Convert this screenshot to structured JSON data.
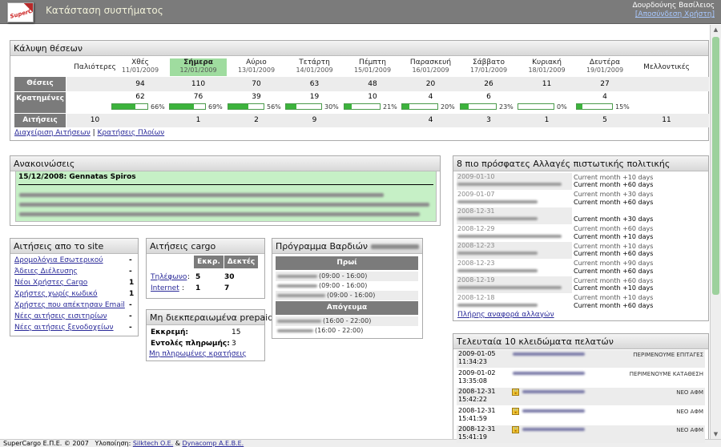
{
  "header": {
    "title": "Κατάσταση συστήματος",
    "user": "Δουρδούνης Βασίλειος",
    "logout": "[Αποσύνδεση Χρήστη]",
    "logo_text": "SuperCargo"
  },
  "coverage": {
    "title": "Κάλυψη θέσεων",
    "days": [
      {
        "name": "Παλιότερες",
        "date": ""
      },
      {
        "name": "Χθές",
        "date": "11/01/2009"
      },
      {
        "name": "Σήμερα",
        "date": "12/01/2009"
      },
      {
        "name": "Αύριο",
        "date": "13/01/2009"
      },
      {
        "name": "Τετάρτη",
        "date": "14/01/2009"
      },
      {
        "name": "Πέμπτη",
        "date": "15/01/2009"
      },
      {
        "name": "Παρασκευή",
        "date": "16/01/2009"
      },
      {
        "name": "Σάββατο",
        "date": "17/01/2009"
      },
      {
        "name": "Κυριακή",
        "date": "18/01/2009"
      },
      {
        "name": "Δευτέρα",
        "date": "19/01/2009"
      },
      {
        "name": "Μελλοντικές",
        "date": ""
      }
    ],
    "row_labels": [
      "Θέσεις",
      "Κρατημένες",
      "Αιτήσεις"
    ],
    "seats": [
      "",
      "94",
      "110",
      "70",
      "63",
      "48",
      "20",
      "26",
      "11",
      "27",
      ""
    ],
    "booked": [
      "",
      "62",
      "76",
      "39",
      "19",
      "10",
      "4",
      "6",
      "",
      "4",
      ""
    ],
    "booked_pct": [
      null,
      66,
      69,
      56,
      30,
      21,
      20,
      23,
      0,
      15,
      null
    ],
    "booked_pct_label": [
      "",
      "66%",
      "69%",
      "56%",
      "30%",
      "21%",
      "20%",
      "23%",
      "0%",
      "15%",
      ""
    ],
    "requests": [
      "10",
      "",
      "1",
      "2",
      "9",
      "",
      "4",
      "3",
      "1",
      "5",
      "11"
    ],
    "link1": "Διαχείριση Αιτήσεων",
    "sep": "|",
    "link2": "Κρατήσεις Πλοίων"
  },
  "announcements": {
    "title": "Ανακοινώσεις",
    "heading": "15/12/2008: Gennatas Spiros"
  },
  "policy": {
    "title": "8 πιο πρόσφατες Αλλαγές πιστωτικής πολιτικής",
    "items": [
      {
        "date": "2009-01-10",
        "desc": "Current month +10 days",
        "desc2": "Current month +60 days"
      },
      {
        "date": "2009-01-07",
        "desc": "Current month +30 days",
        "desc2": "Current month +60 days"
      },
      {
        "date": "2008-12-31",
        "desc": "",
        "desc2": "Current month +30 days"
      },
      {
        "date": "2008-12-29",
        "desc": "Current month +60 days",
        "desc2": "Current month +10 days"
      },
      {
        "date": "2008-12-23",
        "desc": "Current month +10 days",
        "desc2": "Current month +60 days"
      },
      {
        "date": "2008-12-23",
        "desc": "Current month +90 days",
        "desc2": "Current month +60 days"
      },
      {
        "date": "2008-12-19",
        "desc": "Current month +60 days",
        "desc2": "Current month +10 days"
      },
      {
        "date": "2008-12-18",
        "desc": "Current month +10 days",
        "desc2": "Current month +60 days"
      }
    ],
    "link": "Πλήρης αναφορά αλλαγών"
  },
  "site_requests": {
    "title": "Αιτήσεις απο το site",
    "items": [
      {
        "label": "Δρομολόγια Εσωτερικού",
        "val": "-"
      },
      {
        "label": "Άδειες Διέλευσης",
        "val": "-"
      },
      {
        "label": "Νέοι Χρήστες Cargo",
        "val": "1"
      },
      {
        "label": "Χρήστες χωρίς κωδικό",
        "val": "1"
      },
      {
        "label": "Χρήστες που απέκτησαν Email",
        "val": "-"
      },
      {
        "label": "Νέες αιτήσεις εισιτηρίων",
        "val": "-"
      },
      {
        "label": "Νέες αιτήσεις ξενοδοχείων",
        "val": "-"
      }
    ]
  },
  "cargo": {
    "title": "Αιτήσεις cargo",
    "col1": "Εκκρ.",
    "col2": "Δεκτές",
    "rows": [
      {
        "label": "Τηλέφωνο",
        "a": "5",
        "b": "30"
      },
      {
        "label": "Internet",
        "a": "1",
        "b": "7"
      }
    ]
  },
  "prepaid": {
    "title": "Μη διεκπεραιωμένα prepaid",
    "pending_label": "Εκκρεμή:",
    "pending": "15",
    "orders_label": "Εντολές πληρωμής:",
    "orders": "3",
    "link": "Μη πληρωμένες κρατήσεις"
  },
  "shifts": {
    "title": "Πρόγραμμα Βαρδιών",
    "morning": "Πρωί",
    "evening": "Απόγευμα",
    "morning_times": [
      "(09:00 - 16:00)",
      "(09:00 - 16:00)",
      "(09:00 - 16:00)"
    ],
    "evening_times": [
      "(16:00 - 22:00)",
      "(16:00 - 22:00)"
    ]
  },
  "locks": {
    "title": "Τελευταία 10 κλειδώματα πελατών",
    "items": [
      {
        "date": "2009-01-05",
        "time": "11:34:23",
        "status": "ΠΕΡΙΜΕΝΟΥΜΕ ΕΠΙΤΑΓΕΣ"
      },
      {
        "date": "2009-01-02",
        "time": "13:35:08",
        "status": "ΠΕΡΙΜΕΝΟΥΜΕ ΚΑΤΑΘΕΣΗ"
      },
      {
        "date": "2008-12-31",
        "time": "15:42:22",
        "status": "ΝΕΟ ΑΦΜ"
      },
      {
        "date": "2008-12-31",
        "time": "15:41:59",
        "status": "ΝΕΟ ΑΦΜ"
      },
      {
        "date": "2008-12-31",
        "time": "15:41:19",
        "status": "ΝΕΟ ΑΦΜ"
      }
    ]
  },
  "footer": {
    "copy": "SuperCargo Ε.Π.Ε. © 2007",
    "impl": "Υλοποίηση:",
    "c1": "Silktech O.E.",
    "amp": "&",
    "c2": "Dynacomp A.E.B.E."
  }
}
